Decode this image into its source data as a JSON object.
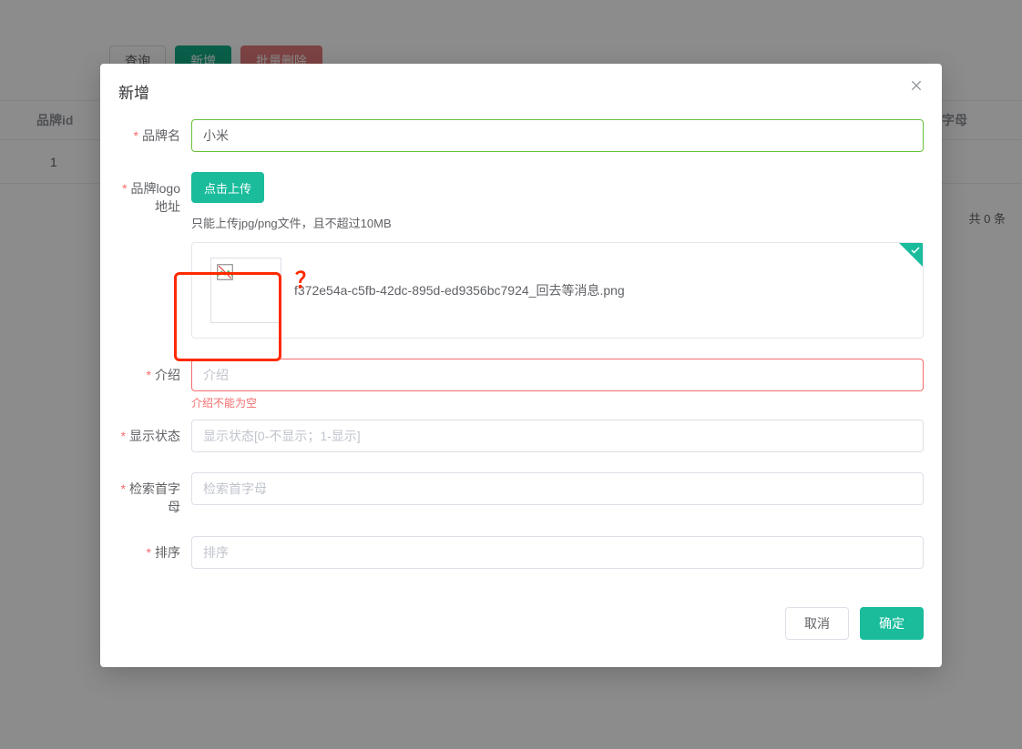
{
  "background": {
    "toolbar": {
      "search_label": "查询",
      "add_label": "新增",
      "batch_delete_label": "批量删除"
    },
    "table": {
      "col_brand_id": "品牌id",
      "col_letter": "字母",
      "row1_id": "1"
    },
    "pager_total": "共 0 条"
  },
  "dialog": {
    "title": "新增",
    "labels": {
      "brand_name": "品牌名",
      "brand_logo": "品牌logo地址",
      "intro": "介绍",
      "show_status": "显示状态",
      "first_letter": "检索首字母",
      "sort": "排序"
    },
    "values": {
      "brand_name": "小米"
    },
    "placeholders": {
      "intro": "介绍",
      "show_status": "显示状态[0-不显示；1-显示]",
      "first_letter": "检索首字母",
      "sort": "排序"
    },
    "upload": {
      "button_label": "点击上传",
      "tip": "只能上传jpg/png文件，且不超过10MB",
      "file_name": "f372e54a-c5fb-42dc-895d-ed9356bc7924_回去等消息.png"
    },
    "errors": {
      "intro": "介绍不能为空"
    },
    "footer": {
      "cancel": "取消",
      "ok": "确定"
    }
  },
  "annotation": {
    "question_mark": "？"
  }
}
